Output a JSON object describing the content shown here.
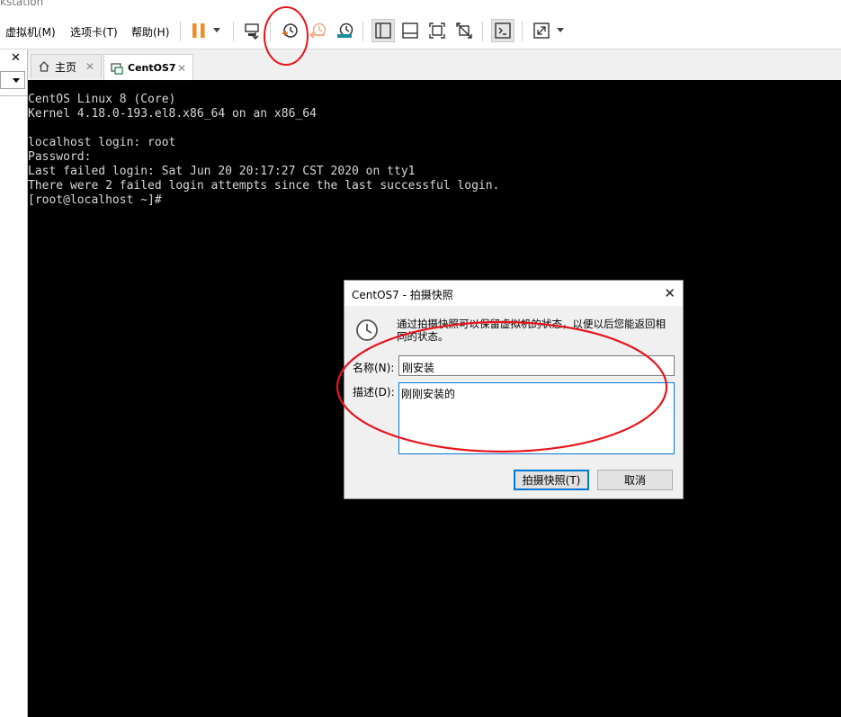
{
  "window": {
    "title_fragment": "kstation"
  },
  "menu": [
    {
      "label": "虚拟机(M)"
    },
    {
      "label": "选项卡(T)"
    },
    {
      "label": "帮助(H)"
    }
  ],
  "toolbar": {
    "icons": [
      "pause-icon",
      "send-ctrl-alt-del-icon",
      "take-snapshot-icon",
      "revert-snapshot-icon",
      "snapshot-manager-icon",
      "sidebar-view-icon",
      "thumbnail-view-icon",
      "fullscreen-icon",
      "unity-icon",
      "console-view-icon",
      "stretch-view-icon"
    ]
  },
  "tabs": [
    {
      "label": "主页",
      "icon": "home-icon"
    },
    {
      "label": "CentOS7",
      "icon": "vm-icon"
    }
  ],
  "console": {
    "lines": [
      "CentOS Linux 8 (Core)",
      "Kernel 4.18.0-193.el8.x86_64 on an x86_64",
      "",
      "localhost login: root",
      "Password:",
      "Last failed login: Sat Jun 20 20:17:27 CST 2020 on tty1",
      "There were 2 failed login attempts since the last successful login.",
      "[root@localhost ~]#"
    ]
  },
  "dialog": {
    "title": "CentOS7 - 拍摄快照",
    "info": "通过拍摄快照可以保留虚拟机的状态，以便以后您能返回相同的状态。",
    "name_label": "名称(N):",
    "name_value": "刚安装",
    "desc_label": "描述(D):",
    "desc_value": "刚刚安装的",
    "ok_label": "拍摄快照(T)",
    "cancel_label": "取消"
  },
  "colors": {
    "pause_orange": "#f08a24",
    "annotation_red": "#e8141b",
    "focus_blue": "#0078d7"
  }
}
